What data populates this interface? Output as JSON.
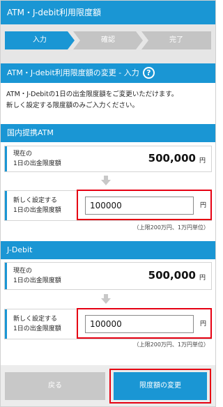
{
  "header": {
    "title": "ATM・J-debit利用限度額"
  },
  "steps": [
    {
      "label": "入力",
      "active": true
    },
    {
      "label": "確認",
      "active": false
    },
    {
      "label": "完了",
      "active": false
    }
  ],
  "section": {
    "title": "ATM・J-debit利用限度額の変更 - 入力",
    "help_icon": "?"
  },
  "intro": {
    "line1": "ATM・J-Debitの1日の出金限度額をご変更いただけます。",
    "line2": "新しく設定する限度額のみご入力ください。"
  },
  "domestic_atm": {
    "title": "国内提携ATM",
    "current_label_1": "現在の",
    "current_label_2": "1日の出金限度額",
    "current_value": "500,000",
    "current_unit": "円",
    "new_label_1": "新しく設定する",
    "new_label_2": "1日の出金限度額",
    "new_value": "100000",
    "new_unit": "円",
    "hint": "（上限200万円、1万円単位）"
  },
  "jdebit": {
    "title": "J-Debit",
    "current_label_1": "現在の",
    "current_label_2": "1日の出金限度額",
    "current_value": "500,000",
    "current_unit": "円",
    "new_label_1": "新しく設定する",
    "new_label_2": "1日の出金限度額",
    "new_value": "100000",
    "new_unit": "円",
    "hint": "（上限200万円、1万円単位）"
  },
  "footer": {
    "back_label": "戻る",
    "submit_label": "限度額の変更"
  },
  "colors": {
    "primary": "#1a96d4",
    "highlight": "#e60012",
    "step_inactive": "#c4c4c4",
    "background_gray": "#e6e6e6"
  }
}
